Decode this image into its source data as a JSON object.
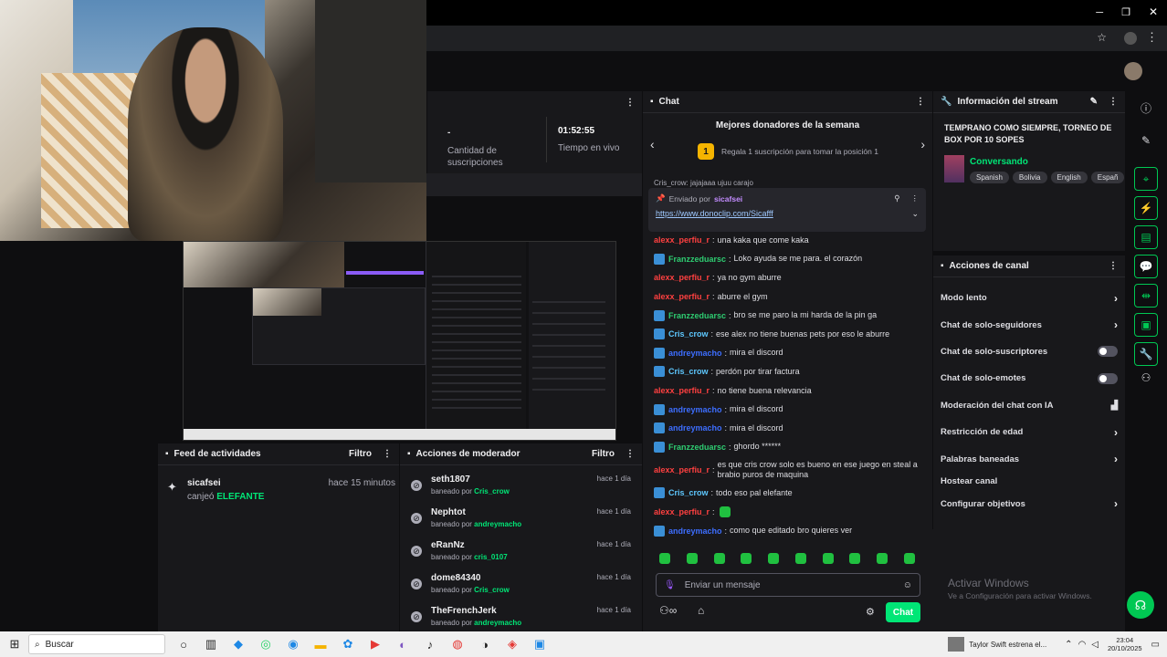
{
  "stats": {
    "subs_value": "-",
    "subs_label": "Cantidad de suscripciones",
    "time_value": "01:52:55",
    "time_label": "Tiempo en vivo"
  },
  "chat": {
    "title": "Chat",
    "donors_title": "Mejores donadores de la semana",
    "donors_rank": "1",
    "donors_text": "Regala 1 suscripción para tomar la posición 1",
    "pinned_by_prefix": "Enviado por",
    "pinned_by_user": "sicafsei",
    "pinned_link": "https://www.donoclip.com/Sicafff",
    "partial_top": "Cris_crow: jajajaaa ujuu carajo",
    "messages": [
      {
        "user": "alexx_perfiu_r",
        "text": "una kaka que come kaka",
        "color": "#ff4040",
        "badge": false
      },
      {
        "user": "Franzzeduarsc",
        "text": "Loko ayuda se me para. el corazón",
        "color": "#2ecc71",
        "badge": true
      },
      {
        "user": "alexx_perfiu_r",
        "text": "ya no gym aburre",
        "color": "#ff4040",
        "badge": false
      },
      {
        "user": "alexx_perfiu_r",
        "text": "aburre el gym",
        "color": "#ff4040",
        "badge": false
      },
      {
        "user": "Franzzeduarsc",
        "text": "bro se me paro la mi harda de la pin ga",
        "color": "#2ecc71",
        "badge": true
      },
      {
        "user": "Cris_crow",
        "text": "ese alex no tiene buenas pets por eso le aburre",
        "color": "#5ec8ff",
        "badge": true
      },
      {
        "user": "andreymacho",
        "text": "mira el discord",
        "color": "#3d6eff",
        "badge": true
      },
      {
        "user": "Cris_crow",
        "text": "perdón por tirar factura",
        "color": "#5ec8ff",
        "badge": true
      },
      {
        "user": "alexx_perfiu_r",
        "text": "no tiene buena relevancia",
        "color": "#ff4040",
        "badge": false
      },
      {
        "user": "andreymacho",
        "text": "mira el discord",
        "color": "#3d6eff",
        "badge": true
      },
      {
        "user": "andreymacho",
        "text": "mira el discord",
        "color": "#3d6eff",
        "badge": true
      },
      {
        "user": "Franzzeduarsc",
        "text": "ghordo ******",
        "color": "#2ecc71",
        "badge": true
      },
      {
        "user": "alexx_perfiu_r",
        "text": "es que cris crow solo es bueno en ese juego en steal a brabio puros de maquina",
        "color": "#ff4040",
        "badge": false
      },
      {
        "user": "Cris_crow",
        "text": "todo eso pal elefante",
        "color": "#5ec8ff",
        "badge": true
      },
      {
        "user": "alexx_perfiu_r",
        "text": "",
        "color": "#ff4040",
        "badge": false
      },
      {
        "user": "andreymacho",
        "text": "como que editado bro quieres ver",
        "color": "#3d6eff",
        "badge": true
      }
    ],
    "input_placeholder": "Enviar un mensaje",
    "send_label": "Chat"
  },
  "stream_info": {
    "title": "Información del stream",
    "stream_title": "TEMPRANO COMO SIEMPRE, TORNEO DE BOX POR 10 SOPES",
    "category": "Conversando",
    "tags": [
      "Spanish",
      "Bolivia",
      "English",
      "Españ"
    ]
  },
  "channel_actions": {
    "title": "Acciones de canal",
    "items": [
      {
        "label": "Modo lento",
        "control": "chevron"
      },
      {
        "label": "Chat de solo-seguidores",
        "control": "chevron"
      },
      {
        "label": "Chat de solo-suscriptores",
        "control": "toggle"
      },
      {
        "label": "Chat de solo-emotes",
        "control": "toggle"
      },
      {
        "label": "Moderación del chat con IA",
        "control": "chart"
      },
      {
        "label": "Restricción de edad",
        "control": "chevron"
      },
      {
        "label": "Palabras baneadas",
        "control": "chevron"
      },
      {
        "label": "Hostear canal",
        "control": "none"
      },
      {
        "label": "Configurar objetivos",
        "control": "chevron"
      }
    ]
  },
  "activity": {
    "title": "Feed de actividades",
    "filter": "Filtro",
    "item_user": "sicafsei",
    "item_time": "hace 15 minutos",
    "item_action": "canjeó",
    "item_reward": "ELEFANTE"
  },
  "modactions": {
    "title": "Acciones de moderador",
    "filter": "Filtro",
    "items": [
      {
        "user": "seth1807",
        "by": "baneado por",
        "mod": "Cris_crow",
        "time": "hace 1 día"
      },
      {
        "user": "Nephtot",
        "by": "baneado por",
        "mod": "andreymacho",
        "time": "hace 1 día"
      },
      {
        "user": "eRanNz",
        "by": "baneado por",
        "mod": "cris_0107",
        "time": "hace 1 día"
      },
      {
        "user": "dome84340",
        "by": "baneado por",
        "mod": "Cris_crow",
        "time": "hace 1 día"
      },
      {
        "user": "TheFrenchJerk",
        "by": "baneado por",
        "mod": "andreymacho",
        "time": "hace 1 día"
      }
    ]
  },
  "watermark": {
    "line1": "Activar Windows",
    "line2": "Ve a Configuración para activar Windows."
  },
  "taskbar": {
    "search": "Buscar",
    "news": "Taylor Swift estrena el...",
    "time": "23:04",
    "date": "20/10/2025"
  }
}
